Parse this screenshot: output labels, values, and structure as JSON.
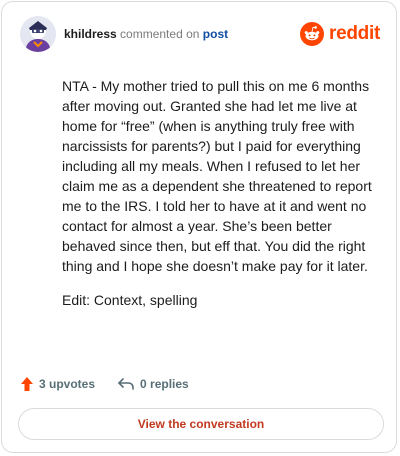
{
  "header": {
    "username": "khildress",
    "action_text": "commented on",
    "target_text": "post",
    "brand_name": "reddit",
    "brand_color": "#ff4500"
  },
  "comment": {
    "paragraphs": [
      "NTA - My mother tried to pull this on me 6 months after moving out. Granted she had let me live at home for “free” (when is anything truly free with narcissists for parents?) but I paid for everything including all my meals. When I refused to let her claim me as a dependent she threatened to report me to the IRS. I told her to have at it and went no contact for almost a year. She’s been better behaved since then, but eff that. You did the right thing and I hope she doesn’t make pay for it later.",
      "Edit: Context, spelling"
    ]
  },
  "stats": {
    "upvotes_label": "3 upvotes",
    "replies_label": "0 replies",
    "upvote_icon": "upvote-arrow-icon",
    "reply_icon": "reply-arrow-icon"
  },
  "cta": {
    "label": "View the conversation"
  },
  "colors": {
    "accent": "#ff4500",
    "link": "#0f4ea3",
    "muted": "#576f76",
    "border": "#d9dcde"
  }
}
